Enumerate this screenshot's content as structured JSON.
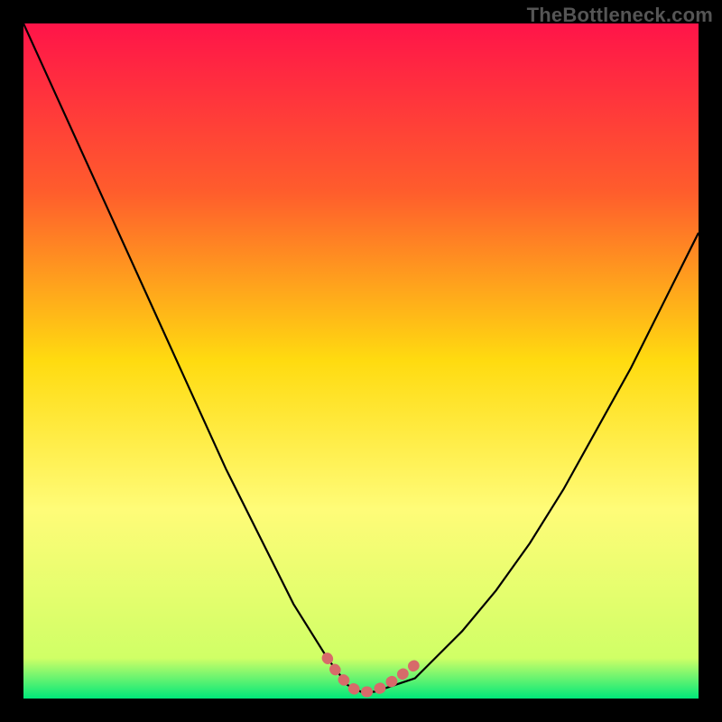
{
  "watermark": "TheBottleneck.com",
  "chart_data": {
    "type": "line",
    "title": "",
    "xlabel": "",
    "ylabel": "",
    "xlim": [
      0,
      100
    ],
    "ylim": [
      0,
      100
    ],
    "grid": false,
    "series": [
      {
        "name": "bottleneck-curve",
        "x": [
          0,
          5,
          10,
          15,
          20,
          25,
          30,
          35,
          40,
          45,
          48,
          50,
          52,
          55,
          58,
          60,
          65,
          70,
          75,
          80,
          85,
          90,
          95,
          100
        ],
        "y": [
          100,
          89,
          78,
          67,
          56,
          45,
          34,
          24,
          14,
          6,
          2,
          1,
          1,
          2,
          3,
          5,
          10,
          16,
          23,
          31,
          40,
          49,
          59,
          69
        ]
      },
      {
        "name": "optimal-range-highlight",
        "x": [
          45,
          46,
          47,
          48,
          49,
          50,
          51,
          52,
          53,
          54,
          55,
          56,
          57,
          58,
          59
        ],
        "y": [
          6,
          4.5,
          3.2,
          2.2,
          1.4,
          1,
          1,
          1.2,
          1.6,
          2.2,
          2.8,
          3.5,
          4.2,
          5,
          5.8
        ]
      }
    ],
    "background_gradient": {
      "stops": [
        {
          "offset": 0,
          "color": "#ff1449"
        },
        {
          "offset": 0.25,
          "color": "#ff5d2c"
        },
        {
          "offset": 0.5,
          "color": "#ffdb10"
        },
        {
          "offset": 0.72,
          "color": "#fffc78"
        },
        {
          "offset": 0.94,
          "color": "#d0ff66"
        },
        {
          "offset": 1.0,
          "color": "#00e87a"
        }
      ]
    },
    "highlight_color": "#d76a6a",
    "curve_color": "#000000"
  }
}
